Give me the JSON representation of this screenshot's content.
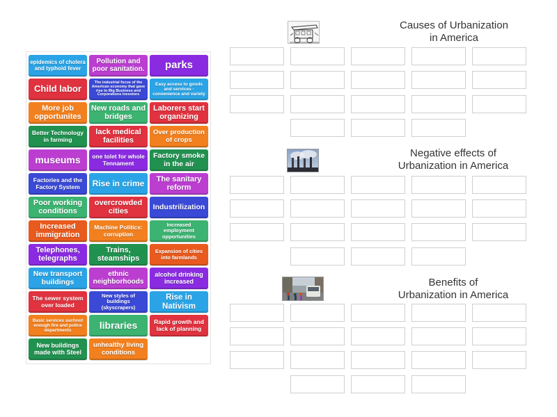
{
  "tiles": [
    {
      "label": "epidemics of cholera and typhoid fever",
      "color": "#2aa4e6",
      "fs": 8
    },
    {
      "label": "Pollution and poor sanitation.",
      "color": "#bb3ed1",
      "fs": 10
    },
    {
      "label": "parks",
      "color": "#8a2be2",
      "fs": 15
    },
    {
      "label": "Child labor",
      "color": "#e0323f",
      "fs": 13
    },
    {
      "label": "The industrial focus of the American economy that gave rise to Big Business and Corporations investors",
      "color": "#3a49d6",
      "fs": 5.5
    },
    {
      "label": "Easy access to goods and services - convenience and variety",
      "color": "#2aa4e6",
      "fs": 6.5
    },
    {
      "label": "More job opportunites",
      "color": "#f2801e",
      "fs": 11
    },
    {
      "label": "New roads and bridges",
      "color": "#3cb371",
      "fs": 11
    },
    {
      "label": "Laborers start organizing",
      "color": "#e0323f",
      "fs": 11
    },
    {
      "label": "Better Technology in farming",
      "color": "#219150",
      "fs": 8.5
    },
    {
      "label": "lack medical facilities",
      "color": "#e0323f",
      "fs": 11
    },
    {
      "label": "Over production of crops",
      "color": "#f2801e",
      "fs": 9.5
    },
    {
      "label": "museums",
      "color": "#bb3ed1",
      "fs": 14
    },
    {
      "label": "one tolet for whole Tennament",
      "color": "#8a2be2",
      "fs": 8.5
    },
    {
      "label": "Factory smoke in the air",
      "color": "#219150",
      "fs": 10.5
    },
    {
      "label": "Factories and the Factory System",
      "color": "#3a49d6",
      "fs": 8.5
    },
    {
      "label": "Rise in crime",
      "color": "#2aa4e6",
      "fs": 12
    },
    {
      "label": "The sanitary reform",
      "color": "#bb3ed1",
      "fs": 11
    },
    {
      "label": "Poor working conditions",
      "color": "#3cb371",
      "fs": 11
    },
    {
      "label": "overcrowded cities",
      "color": "#e0323f",
      "fs": 11
    },
    {
      "label": "Industrilization",
      "color": "#3a49d6",
      "fs": 10.5
    },
    {
      "label": "Increased immigration",
      "color": "#e85a1e",
      "fs": 11
    },
    {
      "label": "Machine Politics: corruption",
      "color": "#f2801e",
      "fs": 8.5
    },
    {
      "label": "Increased employment opportunities",
      "color": "#3cb371",
      "fs": 7.5
    },
    {
      "label": "Telephones, telegraphs",
      "color": "#8a2be2",
      "fs": 11
    },
    {
      "label": "Trains, steamships",
      "color": "#219150",
      "fs": 11
    },
    {
      "label": "Expansion of cities into farmlands",
      "color": "#e85a1e",
      "fs": 7.5
    },
    {
      "label": "New transport buildings",
      "color": "#2aa4e6",
      "fs": 10.5
    },
    {
      "label": "ethnic neighborhoods",
      "color": "#bb3ed1",
      "fs": 10
    },
    {
      "label": "alcohol drinking increased",
      "color": "#8a2be2",
      "fs": 9
    },
    {
      "label": "The sewer system over loaded",
      "color": "#e0323f",
      "fs": 8.5
    },
    {
      "label": "New styles of buildings (skyscrapers)",
      "color": "#3a49d6",
      "fs": 7.5
    },
    {
      "label": "Rise in Nativism",
      "color": "#2aa4e6",
      "fs": 11.5
    },
    {
      "label": "Basic services suchnot enough fire and police departments",
      "color": "#f2801e",
      "fs": 6.5
    },
    {
      "label": "libraries",
      "color": "#3cb371",
      "fs": 14
    },
    {
      "label": "Rapid growth and lack of planning",
      "color": "#e0323f",
      "fs": 8.5
    },
    {
      "label": "New buildings made with Steel",
      "color": "#219150",
      "fs": 9
    },
    {
      "label": "unhealthy living conditions",
      "color": "#f2801e",
      "fs": 9.5
    }
  ],
  "groups": [
    {
      "name": "causes",
      "title_line1": "Causes of Urbanization",
      "title_line2": "in America",
      "image_icon": "horse-carriage-sketch-icon"
    },
    {
      "name": "negative-effects",
      "title_line1": "Negative effects of",
      "title_line2": "Urbanization in America",
      "image_icon": "smokestacks-photo-icon"
    },
    {
      "name": "benefits",
      "title_line1": "Benefits of",
      "title_line2": "Urbanization in America",
      "image_icon": "city-street-photo-icon"
    }
  ]
}
